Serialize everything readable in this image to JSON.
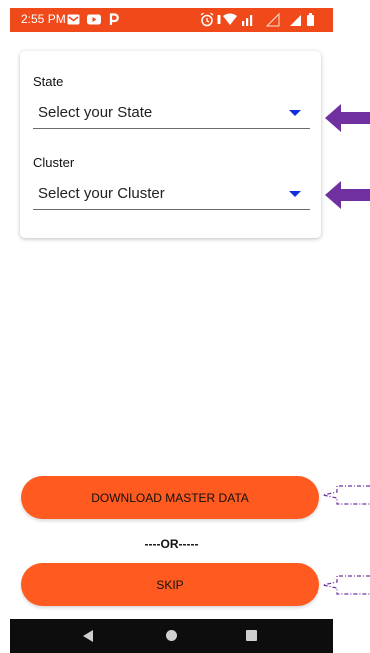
{
  "status_bar": {
    "time": "2:55 PM",
    "left_icons": [
      "gmail-icon",
      "youtube-icon",
      "paytm-icon"
    ],
    "right_icons": [
      "alarm-icon",
      "vibrate-icon",
      "wifi-icon",
      "data-icon",
      "signal-icon",
      "battery-icon"
    ]
  },
  "form": {
    "state": {
      "label": "State",
      "value": "Select your State"
    },
    "cluster": {
      "label": "Cluster",
      "value": "Select your Cluster"
    },
    "dropdown_caret_color": "#1030e0"
  },
  "actions": {
    "download_label": "DOWNLOAD MASTER DATA",
    "or_text": "----OR-----",
    "skip_label": "SKIP",
    "button_color": "#ff5a1f"
  },
  "annotations": {
    "arrow_color": "#7030a0",
    "arrows": [
      "state-pointer-arrow",
      "cluster-pointer-arrow"
    ],
    "callouts": [
      "download-callout",
      "skip-callout"
    ]
  },
  "nav_bar": {
    "items": [
      "back-icon",
      "home-icon",
      "recents-icon"
    ]
  }
}
